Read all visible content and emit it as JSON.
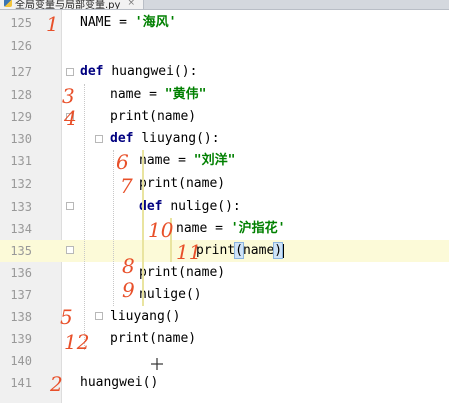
{
  "tab": {
    "filename": "全局变量与局部变量.py",
    "close": "×"
  },
  "lines": [
    {
      "no": "125"
    },
    {
      "no": "126"
    },
    {
      "no": "127"
    },
    {
      "no": "128"
    },
    {
      "no": "129"
    },
    {
      "no": "130"
    },
    {
      "no": "131"
    },
    {
      "no": "132"
    },
    {
      "no": "133"
    },
    {
      "no": "134"
    },
    {
      "no": "135"
    },
    {
      "no": "136"
    },
    {
      "no": "137"
    },
    {
      "no": "138"
    },
    {
      "no": "139"
    },
    {
      "no": "140"
    },
    {
      "no": "141"
    }
  ],
  "code": {
    "l125_a": "NAME = ",
    "l125_s": "'海风'",
    "l127_kw": "def ",
    "l127_b": "huangwei():",
    "l128_a": "name = ",
    "l128_s": "\"黄伟\"",
    "l129": "print(name)",
    "l130_kw": "def ",
    "l130_b": "liuyang():",
    "l131_a": "name = ",
    "l131_s": "\"刘洋\"",
    "l132": "print(name)",
    "l133_kw": "def ",
    "l133_b": "nulige():",
    "l134_a": "name = ",
    "l134_s": "'沪指花'",
    "l135_a": "print",
    "l135_b": "(",
    "l135_c": "name",
    "l135_d": ")",
    "l136": "print(name)",
    "l137": "nulige()",
    "l138": "liuyang()",
    "l139": "print(name)",
    "l141": "huangwei()"
  },
  "annotations": {
    "a125": "1",
    "a128": "3",
    "a129": "4",
    "a131": "6",
    "a132": "7",
    "a134": "10",
    "a135": "11",
    "a136": "8",
    "a137": "9",
    "a138": "5",
    "a139": "12",
    "a141": "2"
  },
  "colors": {
    "keyword": "#000080",
    "string": "#008000",
    "annotation": "#e8502a",
    "current_line": "#fcfad8"
  }
}
